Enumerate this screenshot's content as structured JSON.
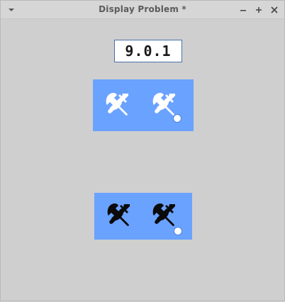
{
  "window": {
    "title": "Display Problem *",
    "controls": {
      "minimize_icon": "minimize-icon",
      "maximize_icon": "maximize-icon",
      "close_icon": "close-icon"
    }
  },
  "content": {
    "version_value": "9.0.1",
    "toolbars": [
      {
        "name": "top-toolbar",
        "style": "white-icons",
        "icons": [
          {
            "icon": "tools-icon"
          },
          {
            "icon": "tools-with-badge-icon"
          }
        ]
      },
      {
        "name": "bottom-toolbar",
        "style": "black-icons",
        "icons": [
          {
            "icon": "tools-icon"
          },
          {
            "icon": "tools-with-badge-icon"
          }
        ]
      }
    ]
  },
  "colors": {
    "panel_blue": "#6aa2ff",
    "window_bg": "#cfcfcf",
    "titlebar_bg": "#d6d6d6",
    "title_text": "#5b5b5b",
    "badge_white": "#ffffff",
    "badge_border": "#4f86dd"
  }
}
